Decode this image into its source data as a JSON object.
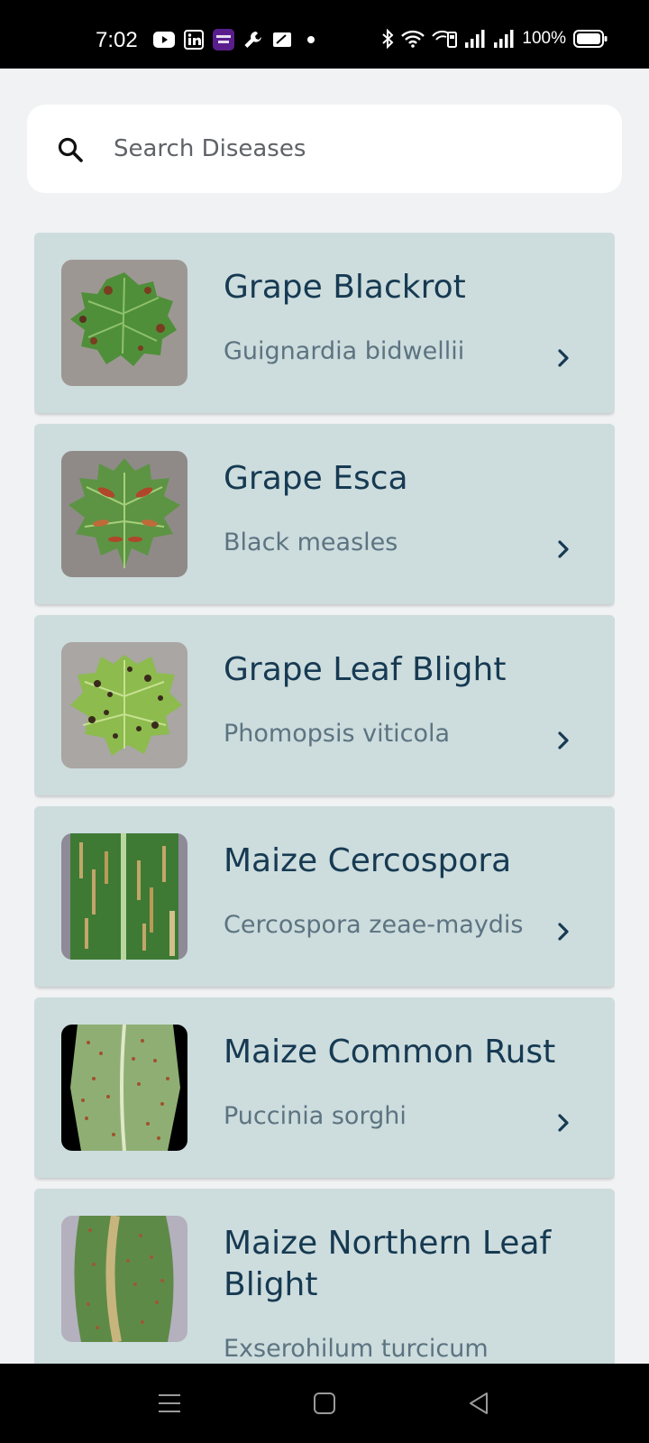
{
  "status_bar": {
    "time": "7:02",
    "battery": "100%",
    "left_icons": [
      "youtube-icon",
      "linkedin-icon",
      "yono-sbi-icon",
      "wrench-icon",
      "card-icon",
      "dot-icon"
    ],
    "right_icons": [
      "bluetooth-icon",
      "wifi-icon",
      "volte-icon",
      "signal-icon",
      "signal-icon",
      "battery-icon"
    ]
  },
  "search": {
    "placeholder": "Search Diseases",
    "icon": "search-icon"
  },
  "diseases": [
    {
      "name": "Grape Blackrot",
      "scientific": "Guignardia bidwellii",
      "thumb": "grape-blackrot-leaf"
    },
    {
      "name": "Grape Esca",
      "scientific": "Black measles",
      "thumb": "grape-esca-leaf"
    },
    {
      "name": "Grape Leaf Blight",
      "scientific": "Phomopsis viticola",
      "thumb": "grape-leaf-blight-leaf"
    },
    {
      "name": "Maize Cercospora",
      "scientific": "Cercospora zeae-maydis",
      "thumb": "maize-cercospora-leaf"
    },
    {
      "name": "Maize Common Rust",
      "scientific": "Puccinia sorghi",
      "thumb": "maize-common-rust-leaf"
    },
    {
      "name": "Maize Northern Leaf Blight",
      "scientific": "Exserohilum turcicum",
      "thumb": "maize-northern-leaf-blight-leaf"
    }
  ],
  "colors": {
    "card_bg": "#cddcdd",
    "title": "#163a52",
    "subtitle": "#5c7481",
    "page_bg": "#f0f2f4"
  },
  "nav": {
    "icons": [
      "menu-icon",
      "home-icon",
      "back-icon"
    ]
  }
}
